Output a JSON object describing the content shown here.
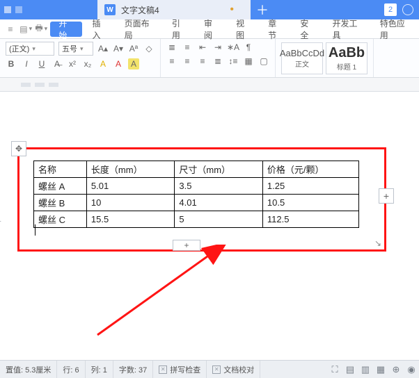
{
  "titlebar": {
    "doc_name": "文字文稿4",
    "numbadge": "2"
  },
  "menu": {
    "items": [
      "开始",
      "插入",
      "页面布局",
      "引用",
      "审阅",
      "视图",
      "章节",
      "安全",
      "开发工具",
      "特色应用"
    ],
    "active_index": 0
  },
  "ribbon": {
    "font_name": "(正文)",
    "font_size": "五号",
    "style_normal": {
      "sample": "AaBbCcDd",
      "label": "正文"
    },
    "style_h1": {
      "sample": "AaBb",
      "label": "标题 1"
    }
  },
  "table": {
    "headers": [
      "名称",
      "长度（mm）",
      "尺寸（mm）",
      "价格（元/颗）"
    ],
    "rows": [
      [
        "螺丝 A",
        "5.01",
        "3.5",
        "1.25"
      ],
      [
        "螺丝 B",
        "10",
        "4.01",
        "10.5"
      ],
      [
        "螺丝 C",
        "15.5",
        "5",
        "112.5"
      ]
    ]
  },
  "status": {
    "position": "置值: 5.3厘米",
    "line": "行: 6",
    "col": "列: 1",
    "chars": "字数: 37",
    "spell": "拼写检查",
    "proof": "文档校对"
  },
  "chart_data": {
    "type": "table",
    "title": "",
    "columns": [
      "名称",
      "长度（mm）",
      "尺寸（mm）",
      "价格（元/颗）"
    ],
    "rows": [
      {
        "名称": "螺丝 A",
        "长度（mm）": 5.01,
        "尺寸（mm）": 3.5,
        "价格（元/颗）": 1.25
      },
      {
        "名称": "螺丝 B",
        "长度（mm）": 10,
        "尺寸（mm）": 4.01,
        "价格（元/颗）": 10.5
      },
      {
        "名称": "螺丝 C",
        "长度（mm）": 15.5,
        "尺寸（mm）": 5,
        "价格（元/颗）": 112.5
      }
    ]
  }
}
